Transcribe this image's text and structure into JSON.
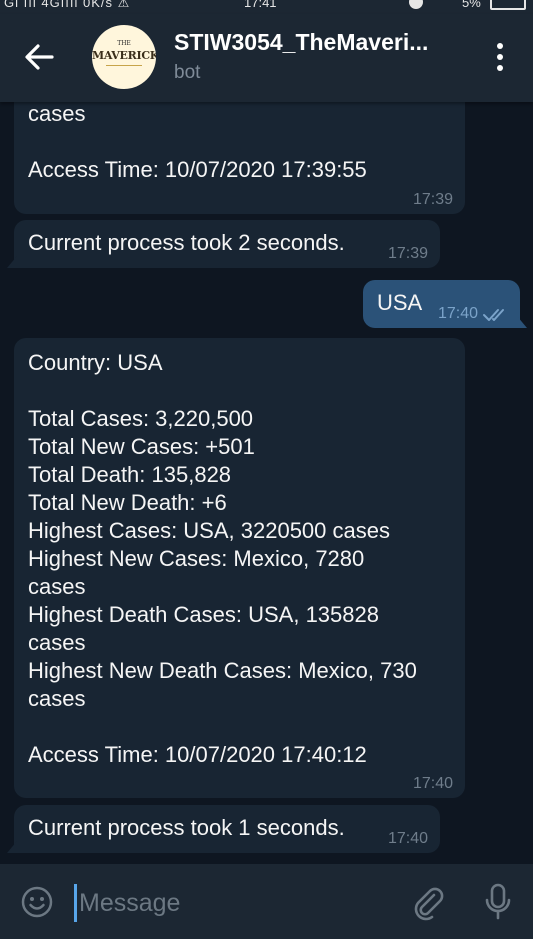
{
  "status_bar": {
    "left": "Gl ııl 4Gıııl 0K/s ⚠",
    "time": "17:41",
    "battery": "5%"
  },
  "header": {
    "avatar_logo_top": "THE",
    "avatar_logo_main": "MAVERICKS",
    "title": "STIW3054_TheMaveri...",
    "subtitle": "bot"
  },
  "messages": [
    {
      "direction": "in",
      "text": "cases\n\nAccess Time: 10/07/2020 17:39:55",
      "time": "17:39"
    },
    {
      "direction": "in",
      "text": "Current process took 2 seconds.",
      "time": "17:39"
    },
    {
      "direction": "out",
      "text": "USA",
      "time": "17:40",
      "read": true
    },
    {
      "direction": "in",
      "text": "Country: USA\n\nTotal Cases: 3,220,500\nTotal New Cases: +501\nTotal Death: 135,828\nTotal New Death: +6\nHighest Cases: USA, 3220500 cases\nHighest New Cases: Mexico, 7280\ncases\nHighest Death Cases: USA, 135828\ncases\nHighest New Death Cases: Mexico, 730\ncases\n\nAccess Time: 10/07/2020 17:40:12",
      "time": "17:40"
    },
    {
      "direction": "in",
      "text": "Current process took 1 seconds.",
      "time": "17:40"
    }
  ],
  "input": {
    "placeholder": "Message",
    "value": ""
  },
  "icons": {
    "back": "arrow-left-icon",
    "menu": "more-vertical-icon",
    "emoji": "emoji-icon",
    "attach": "paperclip-icon",
    "mic": "microphone-icon",
    "read": "double-check-icon"
  },
  "colors": {
    "background": "#0e1621",
    "header": "#1c2733",
    "incoming_bubble": "#182533",
    "outgoing_bubble": "#2b5278",
    "accent": "#58a6ea"
  }
}
